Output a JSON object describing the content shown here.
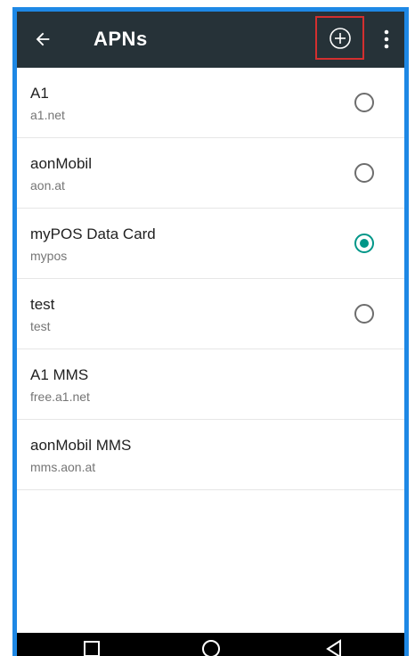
{
  "appbar": {
    "title": "APNs",
    "back_icon": "arrow-left-icon",
    "add_icon": "add-circle-icon",
    "more_icon": "more-vertical-icon",
    "background": "#263238",
    "highlight_color": "#d32f2f"
  },
  "apns": [
    {
      "name": "A1",
      "apn": "a1.net",
      "has_radio": true,
      "selected": false
    },
    {
      "name": "aonMobil",
      "apn": "aon.at",
      "has_radio": true,
      "selected": false
    },
    {
      "name": "myPOS Data Card",
      "apn": "mypos",
      "has_radio": true,
      "selected": true
    },
    {
      "name": "test",
      "apn": "test",
      "has_radio": true,
      "selected": false
    },
    {
      "name": "A1 MMS",
      "apn": "free.a1.net",
      "has_radio": false,
      "selected": false
    },
    {
      "name": "aonMobil MMS",
      "apn": "mms.aon.at",
      "has_radio": false,
      "selected": false
    }
  ],
  "navbar": {
    "icons": [
      "square-recent-icon",
      "circle-home-icon",
      "triangle-back-icon"
    ]
  },
  "colors": {
    "accent": "#009688",
    "frame_blue": "#1e88e5"
  }
}
